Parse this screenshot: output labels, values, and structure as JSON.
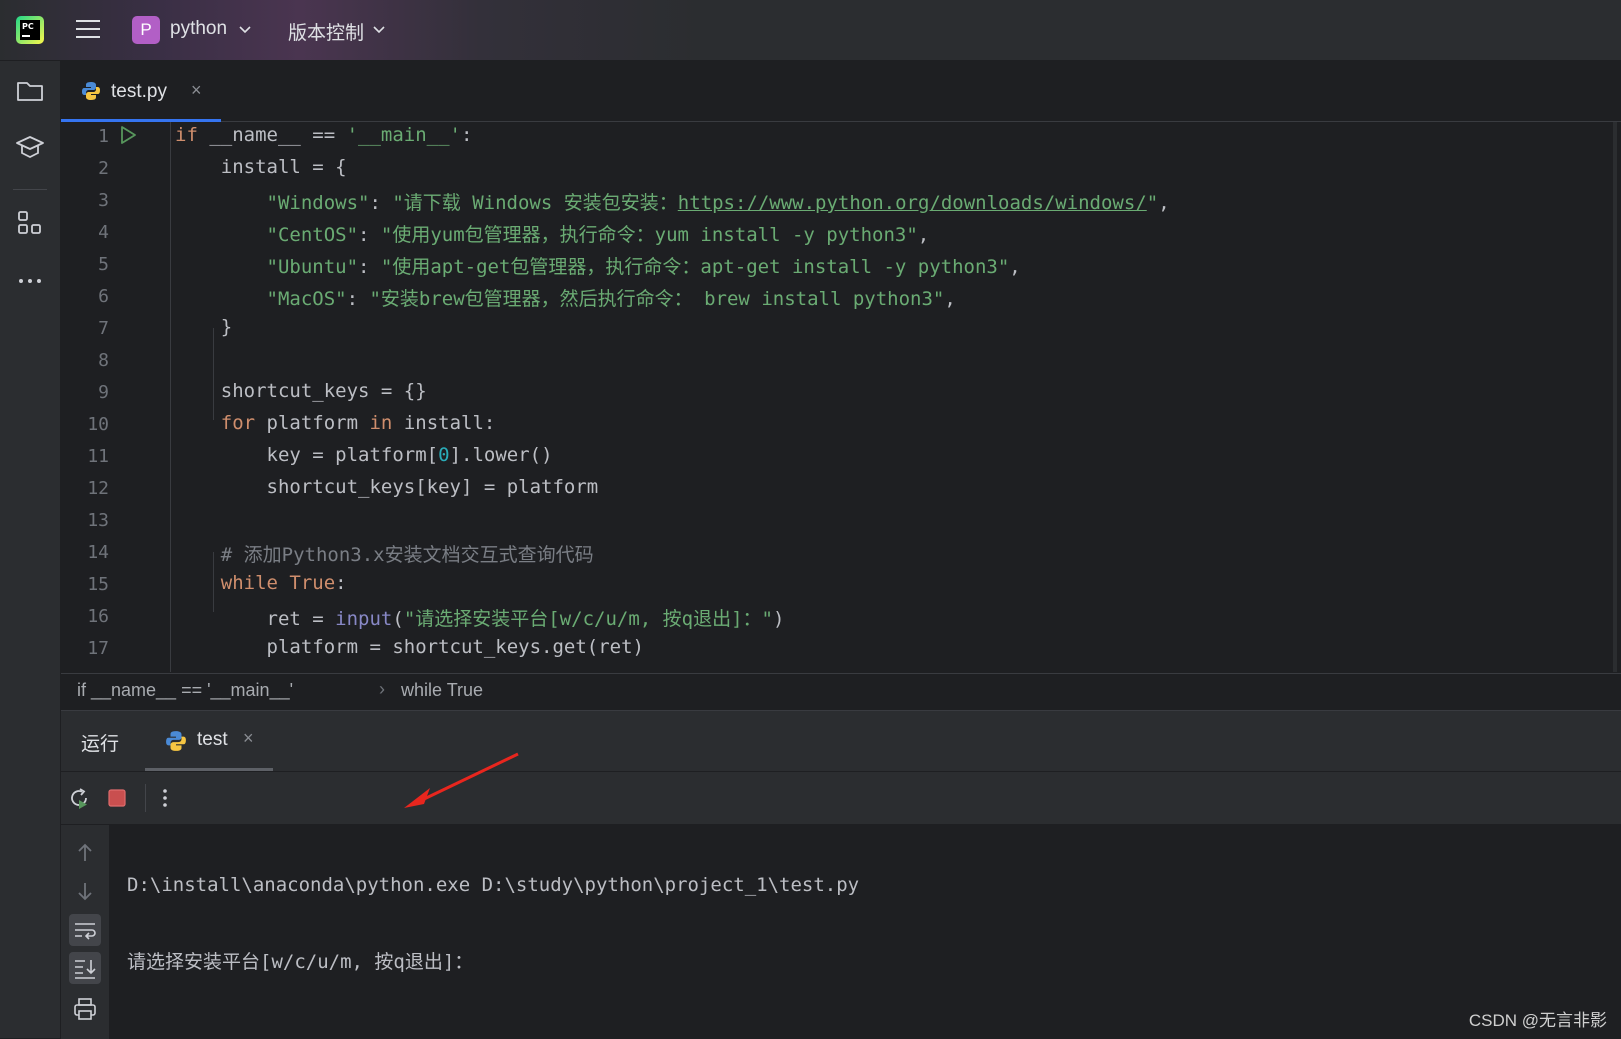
{
  "titlebar": {
    "project_badge": "P",
    "project_name": "python",
    "vcs_label": "版本控制"
  },
  "editor_tab": {
    "filename": "test.py",
    "close": "×"
  },
  "code_lines": [
    {
      "n": "1"
    },
    {
      "n": "2"
    },
    {
      "n": "3"
    },
    {
      "n": "4"
    },
    {
      "n": "5"
    },
    {
      "n": "6"
    },
    {
      "n": "7"
    },
    {
      "n": "8"
    },
    {
      "n": "9"
    },
    {
      "n": "10"
    },
    {
      "n": "11"
    },
    {
      "n": "12"
    },
    {
      "n": "13"
    },
    {
      "n": "14"
    },
    {
      "n": "15"
    },
    {
      "n": "16"
    },
    {
      "n": "17"
    }
  ],
  "code": {
    "l1_kw": "if",
    "l1_mid": " __name__ == ",
    "l1_str": "'__main__'",
    "l1_end": ":",
    "l2": "    install = {",
    "l3_key": "\"Windows\"",
    "l3_mid": ": ",
    "l3_val_a": "\"请下载 Windows 安装包安装：",
    "l3_url": "https://www.python.org/downloads/windows/",
    "l3_val_b": "\"",
    "l3_end": ",",
    "l4_key": "\"CentOS\"",
    "l4_val": "\"使用yum包管理器，执行命令：yum install -y python3\"",
    "l5_key": "\"Ubuntu\"",
    "l5_val": "\"使用apt-get包管理器，执行命令：apt-get install -y python3\"",
    "l6_key": "\"MacOS\"",
    "l6_val": "\"安装brew包管理器，然后执行命令： brew install python3\"",
    "comma": ",",
    "colon": ": ",
    "l7": "    }",
    "l9": "    shortcut_keys = {}",
    "l10_kw1": "for",
    "l10_mid": " platform ",
    "l10_kw2": "in",
    "l10_end": " install:",
    "l11_a": "        key = platform[",
    "l11_num": "0",
    "l11_b": "].lower()",
    "l12": "        shortcut_keys[key] = platform",
    "l14": "# 添加Python3.x安装文档交互式查询代码",
    "l15_kw": "while",
    "l15_true": " True",
    "l15_end": ":",
    "l16_a": "        ret = ",
    "l16_fn": "input",
    "l16_b": "(",
    "l16_str": "\"请选择安装平台[w/c/u/m, 按q退出]：\"",
    "l16_c": ")",
    "l17": "        platform = shortcut_keys.get(ret)"
  },
  "breadcrumb": {
    "item1": "if __name__ == '__main__'",
    "sep": "›",
    "item2": "while True"
  },
  "run_panel": {
    "title": "运行",
    "tab_name": "test",
    "close": "×",
    "console_lines": [
      "D:\\install\\anaconda\\python.exe D:\\study\\python\\project_1\\test.py",
      "请选择安装平台[w/c/u/m, 按q退出]："
    ]
  },
  "icons": {
    "logo": "pycharm-logo-icon",
    "menu": "hamburger-menu-icon",
    "project": "folder-icon",
    "learn": "graduation-cap-icon",
    "structure": "structure-icon",
    "more": "more-icon",
    "rerun": "rerun-icon",
    "stop": "stop-icon",
    "options": "kebab-menu-icon"
  },
  "colors": {
    "keyword": "#cf8e6d",
    "string": "#6aab73",
    "number": "#2aacb8",
    "builtin": "#8888c6",
    "comment": "#7a7e85",
    "accent": "#3574f0",
    "stop_red": "#c94f4f",
    "annotation_arrow": "#e8261e"
  },
  "watermark": "CSDN @无言非影"
}
